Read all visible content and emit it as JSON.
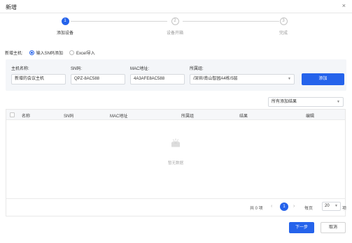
{
  "dialog": {
    "title": "新增",
    "close_glyph": "×"
  },
  "steps": [
    {
      "num": "1",
      "label": "添加设备"
    },
    {
      "num": "2",
      "label": "设备开箱"
    },
    {
      "num": "3",
      "label": "完成"
    }
  ],
  "active_step": 1,
  "mode": {
    "label": "新增主机:",
    "options": [
      {
        "label": "输入SN码添加",
        "selected": true
      },
      {
        "label": "Excel导入",
        "selected": false
      }
    ]
  },
  "form": {
    "host_name": {
      "label": "主机名称:",
      "value": "新增的会议主机"
    },
    "sn": {
      "label": "SN码:",
      "value": "QPZ-8AC588"
    },
    "mac": {
      "label": "MAC地址:",
      "value": "4A3AFE8AC588"
    },
    "group": {
      "label": "所属组:",
      "value": "/深圳/南山智园A4栋/5层"
    },
    "add_button": "添加"
  },
  "result_filter": {
    "value": "所有添加结果"
  },
  "table": {
    "columns": [
      "名称",
      "SN码",
      "MAC地址",
      "所属组",
      "结果",
      "编辑"
    ],
    "rows": [],
    "empty_text": "暂无数据"
  },
  "pagination": {
    "total": "共 0 项",
    "current_page": "1",
    "per_page_label": "每页",
    "per_page": "20",
    "unit": "项"
  },
  "footer": {
    "next": "下一步",
    "cancel": "取消"
  },
  "colors": {
    "primary": "#2563eb",
    "panel_bg": "#f4f6f9"
  }
}
